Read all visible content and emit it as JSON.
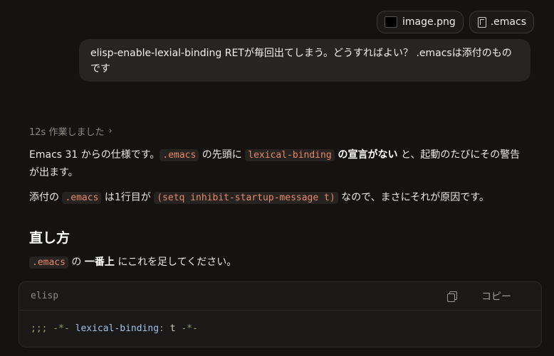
{
  "attachments": [
    {
      "label": "image.png",
      "icon": "image-thumbnail"
    },
    {
      "label": ".emacs",
      "icon": "file-icon"
    }
  ],
  "user_message": "elisp-enable-lexial-binding RETが毎回出てしまう。どうすればよい？ .emacsは添付のものです",
  "thought": {
    "label": "12s 作業しました",
    "icon": "chevron-right-icon"
  },
  "para1": {
    "t1": "Emacs 31 からの仕様です。",
    "c1": ".emacs",
    "t2": " の先頭に ",
    "c2": "lexical-binding",
    "b1": " の宣言がない",
    "t3": " と、起動のたびにその警告が出ます。"
  },
  "para2": {
    "t1": "添付の ",
    "c1": ".emacs",
    "t2": " は1行目が ",
    "c2": "(setq inhibit-startup-message t)",
    "t3": " なので、まさにそれが原因です。"
  },
  "heading": "直し方",
  "para3": {
    "c1": ".emacs",
    "t1": " の ",
    "b1": "一番上",
    "t2": " にこれを足してください。"
  },
  "code_block": {
    "lang": "elisp",
    "copy_label": "コピー",
    "tokens": {
      "prefix": ";;; -*- ",
      "key": "lexical-binding",
      "sep": ": ",
      "val": "t",
      "suffix": " -*-"
    }
  }
}
